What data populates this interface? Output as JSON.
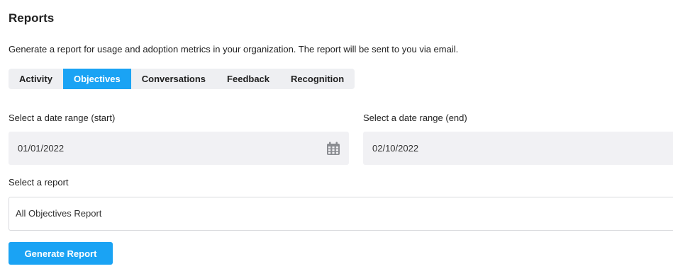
{
  "page": {
    "title": "Reports",
    "description": "Generate a report for usage and adoption metrics in your organization. The report will be sent to you via email."
  },
  "tabs": [
    {
      "label": "Activity",
      "active": false
    },
    {
      "label": "Objectives",
      "active": true
    },
    {
      "label": "Conversations",
      "active": false
    },
    {
      "label": "Feedback",
      "active": false
    },
    {
      "label": "Recognition",
      "active": false
    }
  ],
  "date_range": {
    "start_label": "Select a date range (start)",
    "start_value": "01/01/2022",
    "start_icon": "calendar-icon",
    "end_label": "Select a date range (end)",
    "end_value": "02/10/2022"
  },
  "report": {
    "label": "Select a report",
    "selected": "All Objectives Report"
  },
  "actions": {
    "generate_label": "Generate Report"
  },
  "colors": {
    "accent": "#1aa3f4",
    "field_bg": "#f1f1f4",
    "tab_bg": "#eeeff2"
  }
}
